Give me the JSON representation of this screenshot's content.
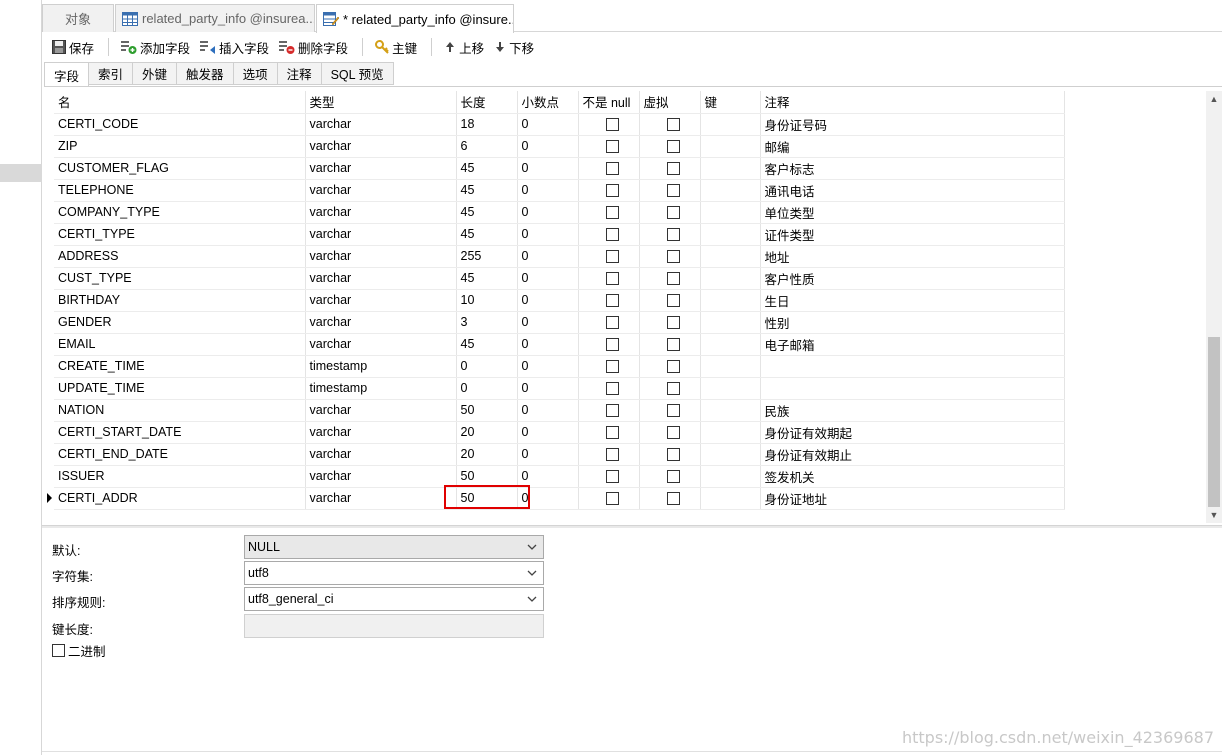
{
  "tabs": [
    {
      "label": "对象",
      "icon": "none"
    },
    {
      "label": "related_party_info @insurea...",
      "icon": "table-icon"
    },
    {
      "label": "* related_party_info @insure...",
      "icon": "table-design-icon"
    }
  ],
  "toolbar": {
    "save": "保存",
    "add_field": "添加字段",
    "insert_field": "插入字段",
    "delete_field": "删除字段",
    "primary_key": "主键",
    "move_up": "上移",
    "move_down": "下移"
  },
  "subtabs": [
    "字段",
    "索引",
    "外键",
    "触发器",
    "选项",
    "注释",
    "SQL 预览"
  ],
  "grid": {
    "headers": {
      "name": "名",
      "type": "类型",
      "length": "长度",
      "decimals": "小数点",
      "not_null": "不是 null",
      "virtual": "虚拟",
      "key": "键",
      "comment": "注释"
    },
    "rows": [
      {
        "name": "CERTI_CODE",
        "type": "varchar",
        "length": "18",
        "decimals": "0",
        "comment": "身份证号码"
      },
      {
        "name": "ZIP",
        "type": "varchar",
        "length": "6",
        "decimals": "0",
        "comment": "邮编"
      },
      {
        "name": "CUSTOMER_FLAG",
        "type": "varchar",
        "length": "45",
        "decimals": "0",
        "comment": "客户标志"
      },
      {
        "name": "TELEPHONE",
        "type": "varchar",
        "length": "45",
        "decimals": "0",
        "comment": "通讯电话"
      },
      {
        "name": "COMPANY_TYPE",
        "type": "varchar",
        "length": "45",
        "decimals": "0",
        "comment": "单位类型"
      },
      {
        "name": "CERTI_TYPE",
        "type": "varchar",
        "length": "45",
        "decimals": "0",
        "comment": "证件类型"
      },
      {
        "name": "ADDRESS",
        "type": "varchar",
        "length": "255",
        "decimals": "0",
        "comment": "地址"
      },
      {
        "name": "CUST_TYPE",
        "type": "varchar",
        "length": "45",
        "decimals": "0",
        "comment": "客户性质"
      },
      {
        "name": "BIRTHDAY",
        "type": "varchar",
        "length": "10",
        "decimals": "0",
        "comment": "生日"
      },
      {
        "name": "GENDER",
        "type": "varchar",
        "length": "3",
        "decimals": "0",
        "comment": "性别"
      },
      {
        "name": "EMAIL",
        "type": "varchar",
        "length": "45",
        "decimals": "0",
        "comment": "电子邮箱"
      },
      {
        "name": "CREATE_TIME",
        "type": "timestamp",
        "length": "0",
        "decimals": "0",
        "comment": ""
      },
      {
        "name": "UPDATE_TIME",
        "type": "timestamp",
        "length": "0",
        "decimals": "0",
        "comment": ""
      },
      {
        "name": "NATION",
        "type": "varchar",
        "length": "50",
        "decimals": "0",
        "comment": "民族"
      },
      {
        "name": "CERTI_START_DATE",
        "type": "varchar",
        "length": "20",
        "decimals": "0",
        "comment": "身份证有效期起"
      },
      {
        "name": "CERTI_END_DATE",
        "type": "varchar",
        "length": "20",
        "decimals": "0",
        "comment": "身份证有效期止"
      },
      {
        "name": "ISSUER",
        "type": "varchar",
        "length": "50",
        "decimals": "0",
        "comment": "签发机关"
      },
      {
        "name": "CERTI_ADDR",
        "type": "varchar",
        "length": "50",
        "decimals": "0",
        "comment": "身份证地址"
      }
    ]
  },
  "props": {
    "default_label": "默认:",
    "default_value": "NULL",
    "charset_label": "字符集:",
    "charset_value": "utf8",
    "collation_label": "排序规则:",
    "collation_value": "utf8_general_ci",
    "key_length_label": "键长度:",
    "key_length_value": "",
    "binary_label": "二进制"
  },
  "watermark": "https://blog.csdn.net/weixin_42369687",
  "colors": {
    "highlight": "#e00000",
    "selected_row_marker": "#000000"
  }
}
